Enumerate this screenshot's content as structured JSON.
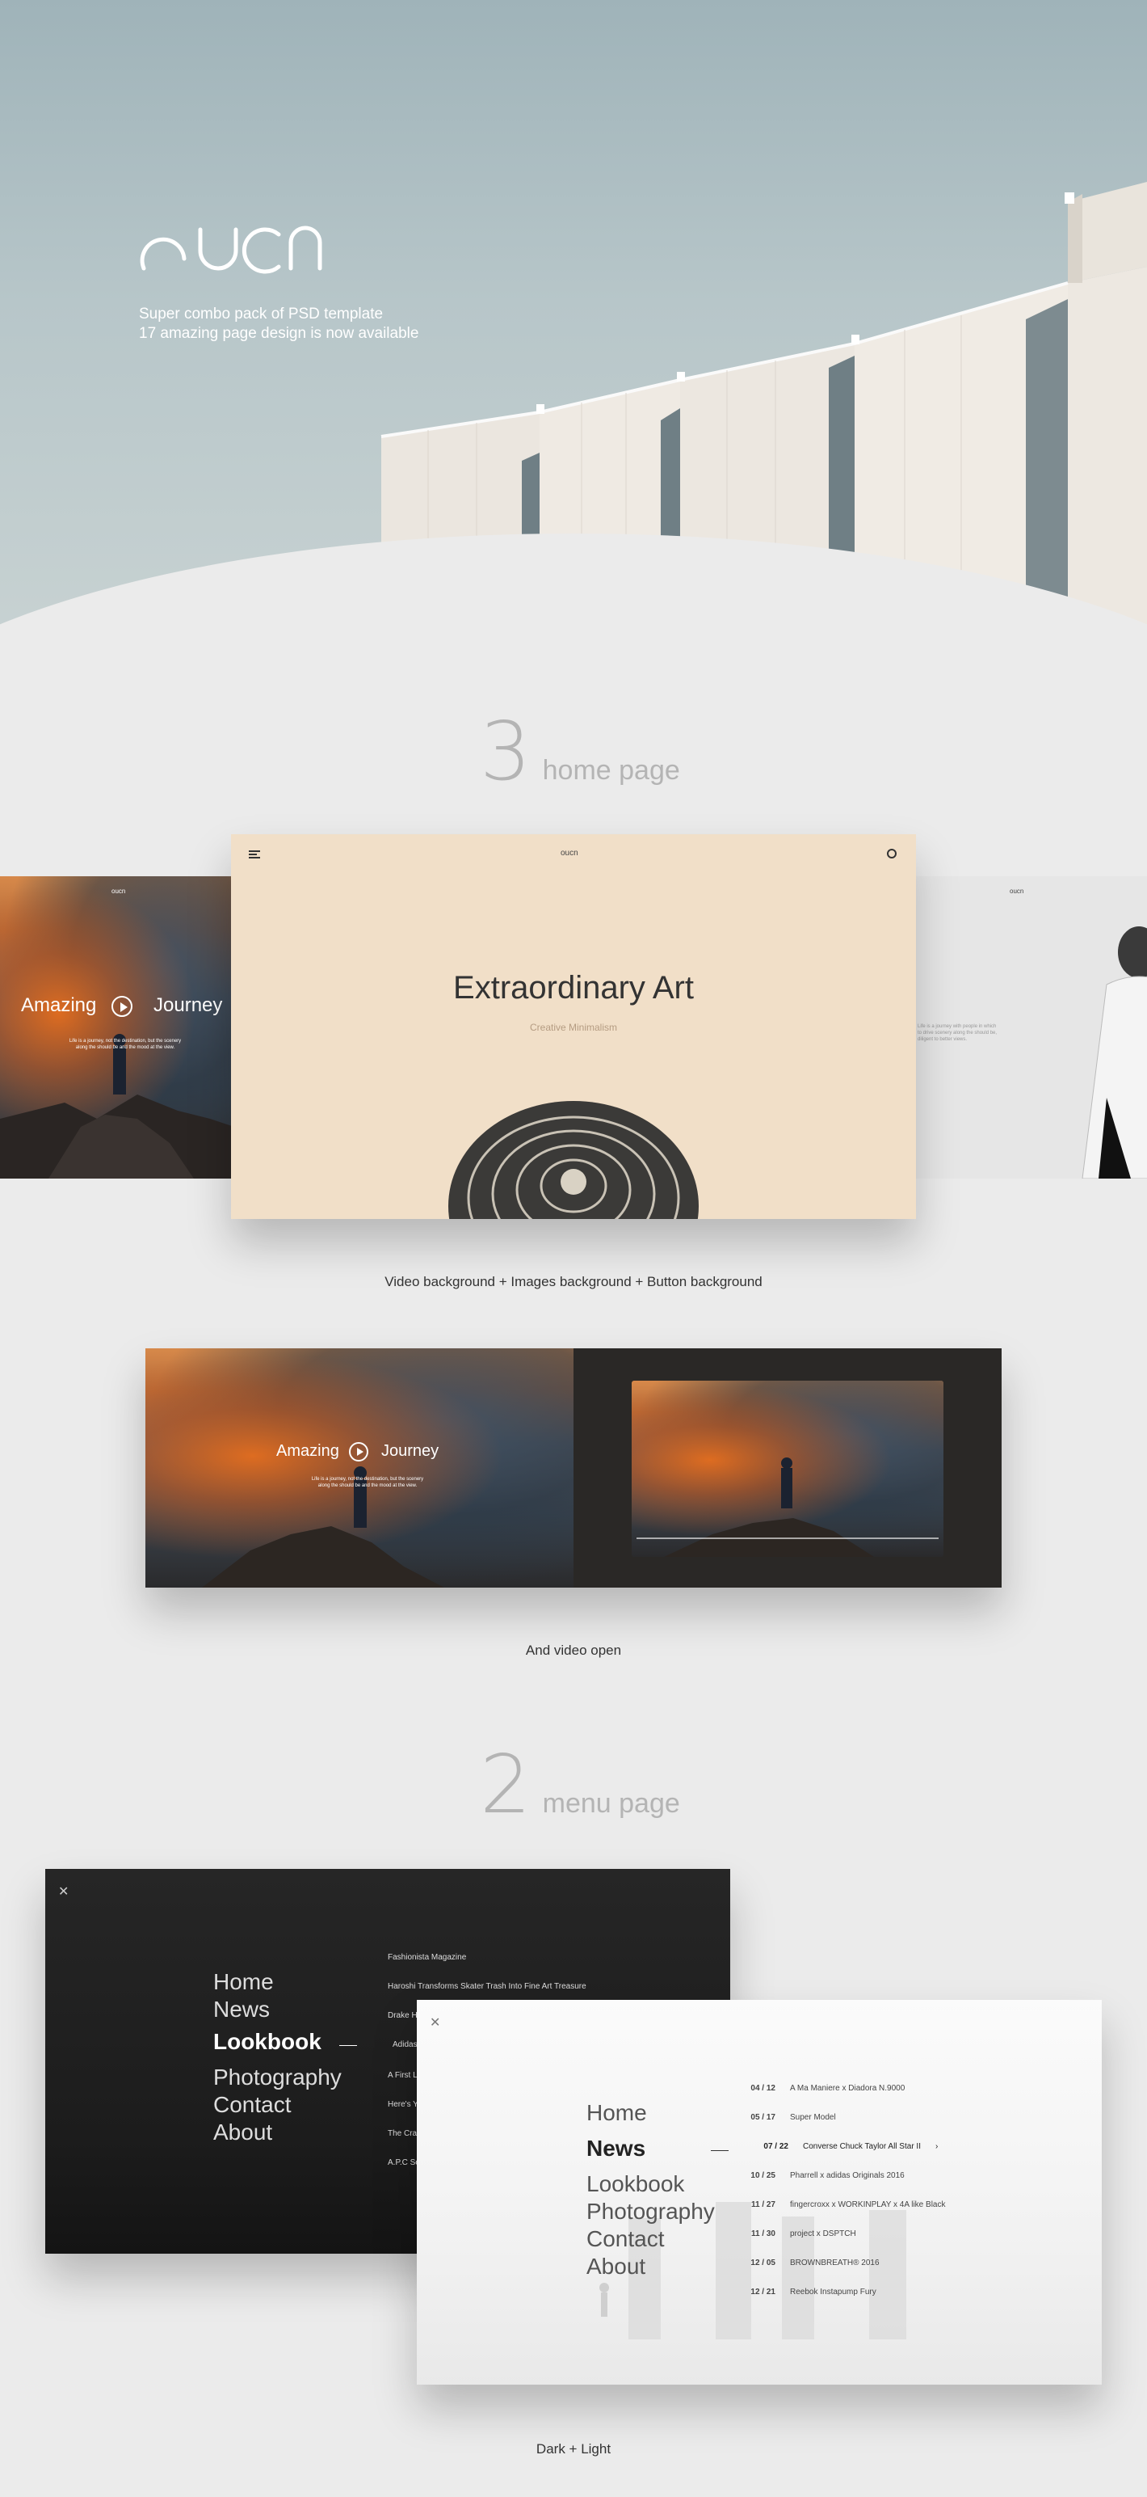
{
  "hero": {
    "logo": "oucn",
    "tagline_1": "Super combo pack of PSD template",
    "tagline_2": "17 amazing page design is now available"
  },
  "home_section": {
    "number": "3",
    "word": "home page",
    "main_preview": {
      "logo": "oucn",
      "title": "Extraordinary Art",
      "subtitle": "Creative Minimalism"
    },
    "left_preview": {
      "logo": "oucn",
      "word_1": "Amazing",
      "word_2": "Journey",
      "blurb": "Life is a journey, not the destination, but the scenery along the should be and the mood at the view."
    },
    "right_preview": {
      "logo": "oucn",
      "blurb": "Life is a journey with people in which to drive scenery along the should be, diligent to better views."
    },
    "caption": "Video background + Images background + Button background"
  },
  "video_section": {
    "left": {
      "word_1": "Amazing",
      "word_2": "Journey",
      "blurb": "Life is a journey, not the destination, but the scenery along the should be and the mood at the view."
    },
    "caption": "And video open"
  },
  "menu_section": {
    "number": "2",
    "word": "menu page",
    "dark_menu": [
      "Home",
      "News",
      "Lookbook",
      "Photography",
      "Contact",
      "About"
    ],
    "dark_side": [
      "Fashionista Magazine",
      "Haroshi Transforms Skater Trash Into Fine Art Treasure",
      "Drake Ho",
      "Adidas",
      "A First Lo",
      "Here's Yo",
      "The Craz",
      "A.P.C Se"
    ],
    "light_menu": [
      "Home",
      "News",
      "Lookbook",
      "Photography",
      "Contact",
      "About"
    ],
    "light_news": [
      {
        "date": "04 / 12",
        "title": "A Ma Maniere x Diadora N.9000"
      },
      {
        "date": "05 / 17",
        "title": "Super Model"
      },
      {
        "date": "07 / 22",
        "title": "Converse Chuck Taylor All Star II"
      },
      {
        "date": "10 / 25",
        "title": "Pharrell x adidas Originals 2016"
      },
      {
        "date": "11 / 27",
        "title": "fingercroxx x WORKINPLAY x 4A like Black"
      },
      {
        "date": "11 / 30",
        "title": "project x DSPTCH"
      },
      {
        "date": "12 / 05",
        "title": "BROWNBREATH® 2016"
      },
      {
        "date": "12 / 21",
        "title": "Reebok Instapump Fury"
      }
    ],
    "caption": "Dark + Light"
  }
}
